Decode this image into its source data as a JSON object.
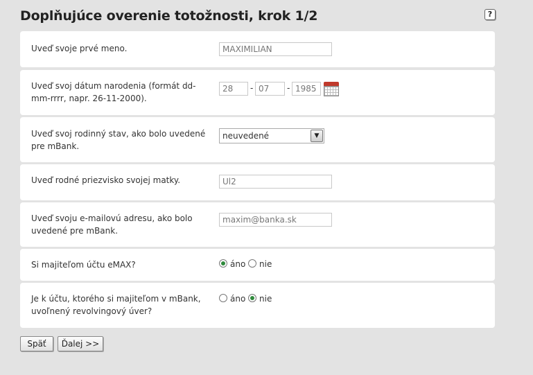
{
  "page": {
    "title": "Doplňujúce overenie totožnosti, krok 1/2",
    "help_label": "?"
  },
  "form": {
    "first_name": {
      "label": "Uveď svoje prvé meno.",
      "value": "MAXIMILIAN"
    },
    "birth_date": {
      "label": "Uveď svoj dátum narodenia (formát dd-mm-rrrr, napr. 26-11-2000).",
      "day": "28",
      "month": "07",
      "year": "1985",
      "separator": "-",
      "calendar_icon": "calendar-icon"
    },
    "marital_status": {
      "label": "Uveď svoj rodinný stav, ako bolo uvedené pre mBank.",
      "selected": "neuvedené"
    },
    "mother_maiden_name": {
      "label": "Uveď rodné priezvisko svojej matky.",
      "value": "Ul2"
    },
    "email": {
      "label": "Uveď svoju e-mailovú adresu, ako bolo uvedené pre mBank.",
      "value": "maxim@banka.sk"
    },
    "emax_owner": {
      "label": "Si majiteľom účtu eMAX?",
      "yes": "áno",
      "no": "nie",
      "selected": "yes"
    },
    "revolving_credit": {
      "label": "Je k účtu, ktorého si majiteľom v mBank, uvoľnený revolvingový úver?",
      "yes": "áno",
      "no": "nie",
      "selected": "no"
    }
  },
  "buttons": {
    "back": "Späť",
    "next": "Ďalej >>"
  },
  "colors": {
    "radio_selected": "#2f8a3c",
    "calendar": "#c0392b"
  }
}
